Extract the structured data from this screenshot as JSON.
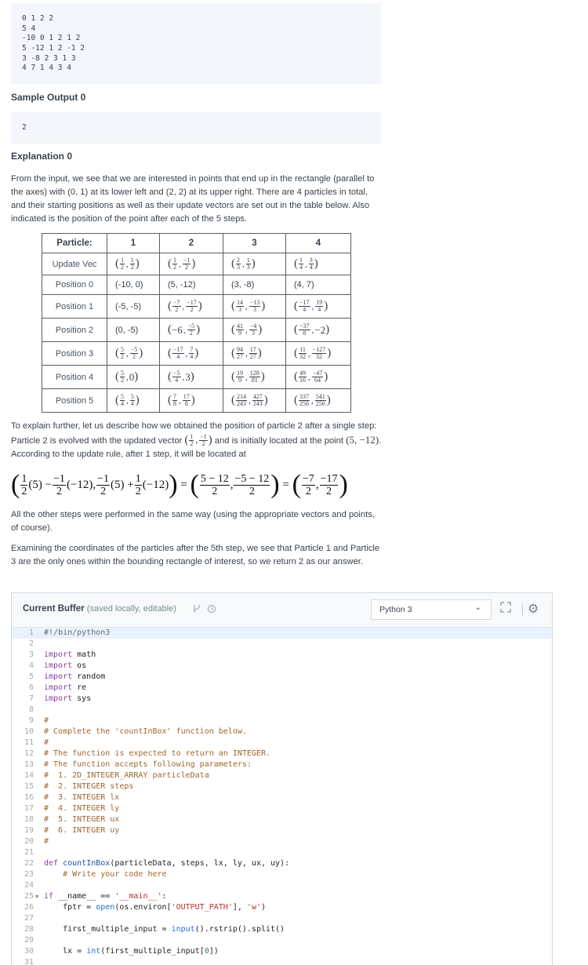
{
  "sample_input": {
    "lines": [
      "0 1 2 2",
      "5 4",
      "-10 0 1 2 1 2",
      "5 -12 1 2 -1 2",
      "3 -8 2 3 1 3",
      "4 7 1 4 3 4"
    ]
  },
  "sample_output": {
    "heading": "Sample Output 0",
    "value": "2"
  },
  "explanation": {
    "heading": "Explanation 0",
    "para1": "From the input, we see that we are interested in points that end up in the rectangle (parallel to the axes) with (0, 1) at its lower left and (2, 2) at its upper right. There are 4 particles in total, and their starting positions as well as their update vectors are set out in the table below. Also indicated is the position of the point after each of the 5 steps.",
    "para2_a": "To explain further, let us describe how we obtained the position of particle 2 after a single step: Particle 2 is evolved with the updated vector ",
    "para2_b": " and is initially located at the point ",
    "para2_point": "(5, −12)",
    "para2_c": ". According to the update rule, after 1 step, it will be located at",
    "para3": "All the other steps were performed in the same way (using the appropriate vectors and points, of course).",
    "para4": "Examining the coordinates of the particles after the 5th step, we see that Particle 1 and Particle 3 are the only ones within the bounding rectangle of interest, so we return 2 as our answer.",
    "inline_vector": [
      [
        "1",
        "2"
      ],
      [
        "−1",
        "2"
      ]
    ]
  },
  "table": {
    "header": [
      "Particle:",
      "1",
      "2",
      "3",
      "4"
    ],
    "rows": [
      {
        "label": "Update Vec",
        "cells": [
          [
            [
              "1",
              "2"
            ],
            [
              "1",
              "2"
            ]
          ],
          [
            [
              "1",
              "2"
            ],
            [
              "−1",
              "2"
            ]
          ],
          [
            [
              "2",
              "3"
            ],
            [
              "1",
              "3"
            ]
          ],
          [
            [
              "1",
              "4"
            ],
            [
              "3",
              "4"
            ]
          ]
        ]
      },
      {
        "label": "Position 0",
        "cells": [
          "(-10, 0)",
          "(5, -12)",
          "(3, -8)",
          "(4, 7)"
        ]
      },
      {
        "label": "Position 1",
        "cells": [
          "(-5, -5)",
          [
            [
              "−7",
              "2"
            ],
            [
              "−17",
              "2"
            ]
          ],
          [
            [
              "14",
              "3"
            ],
            [
              "−13",
              "3"
            ]
          ],
          [
            [
              "−17",
              "4"
            ],
            [
              "19",
              "4"
            ]
          ]
        ]
      },
      {
        "label": "Position 2",
        "cells": [
          "(0, -5)",
          [
            [
              "−6"
            ],
            [
              "−5",
              "2"
            ]
          ],
          [
            [
              "41",
              "9"
            ],
            [
              "−4",
              "3"
            ]
          ],
          [
            [
              "−37",
              "8"
            ],
            [
              "−2"
            ]
          ]
        ]
      },
      {
        "label": "Position 3",
        "cells": [
          [
            [
              "5",
              "2"
            ],
            [
              "−5",
              "2"
            ]
          ],
          [
            [
              "−17",
              "4"
            ],
            [
              "7",
              "4"
            ]
          ],
          [
            [
              "94",
              "27"
            ],
            [
              "17",
              "27"
            ]
          ],
          [
            [
              "11",
              "32"
            ],
            [
              "−127",
              "32"
            ]
          ]
        ]
      },
      {
        "label": "Position 4",
        "cells": [
          [
            [
              "5",
              "2"
            ],
            [
              "0"
            ]
          ],
          [
            [
              "−5",
              "4"
            ],
            [
              "3"
            ]
          ],
          [
            [
              "19",
              "9"
            ],
            [
              "128",
              "81"
            ]
          ],
          [
            [
              "49",
              "16"
            ],
            [
              "−47",
              "64"
            ]
          ]
        ]
      },
      {
        "label": "Position 5",
        "cells": [
          [
            [
              "5",
              "4"
            ],
            [
              "5",
              "4"
            ]
          ],
          [
            [
              "7",
              "8"
            ],
            [
              "17",
              "8"
            ]
          ],
          [
            [
              "214",
              "243"
            ],
            [
              "427",
              "243"
            ]
          ],
          [
            [
              "337",
              "256"
            ],
            [
              "541",
              "256"
            ]
          ]
        ]
      }
    ]
  },
  "formula": {
    "text": "(1/2(5) − (−1/2)(−12), (−1/2)(5) + 1/2(−12)) = ((5−12)/2, (−5−12)/2) = (−7/2, −17/2)"
  },
  "editor": {
    "title": "Current Buffer",
    "subtitle": "(saved locally, editable)",
    "language": "Python 3",
    "icons": [
      "branch-icon",
      "history-icon",
      "fullscreen-icon",
      "settings-icon"
    ],
    "lines": [
      "#!/bin/python3",
      "",
      "import math",
      "import os",
      "import random",
      "import re",
      "import sys",
      "",
      "#",
      "# Complete the 'countInBox' function below.",
      "#",
      "# The function is expected to return an INTEGER.",
      "# The function accepts following parameters:",
      "#  1. 2D_INTEGER_ARRAY particleData",
      "#  2. INTEGER steps",
      "#  3. INTEGER lx",
      "#  4. INTEGER ly",
      "#  5. INTEGER ux",
      "#  6. INTEGER uy",
      "#",
      "",
      "def countInBox(particleData, steps, lx, ly, ux, uy):",
      "    # Write your code here",
      "",
      "if __name__ == '__main__':",
      "    fptr = open(os.environ['OUTPUT_PATH'], 'w')",
      "",
      "    first_multiple_input = input().rstrip().split()",
      "",
      "    lx = int(first_multiple_input[0])",
      ""
    ]
  }
}
